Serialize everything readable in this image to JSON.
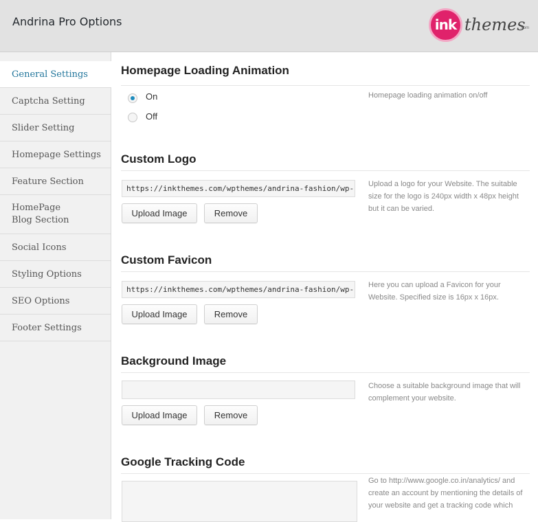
{
  "header": {
    "title": "Andrina Pro Options",
    "logo": {
      "mark": "ink",
      "wordmark": "themes",
      "suffix": ".com"
    }
  },
  "sidebar": {
    "items": [
      {
        "label": "General Settings",
        "active": true
      },
      {
        "label": "Captcha Setting"
      },
      {
        "label": "Slider Setting"
      },
      {
        "label": "Homepage Settings"
      },
      {
        "label": "Feature Section"
      },
      {
        "label": "HomePage Blog Section"
      },
      {
        "label": "Social Icons"
      },
      {
        "label": "Styling Options"
      },
      {
        "label": "SEO Options"
      },
      {
        "label": "Footer Settings"
      }
    ]
  },
  "sections": {
    "animation": {
      "title": "Homepage Loading Animation",
      "options": [
        "On",
        "Off"
      ],
      "selected": "On",
      "description": "Homepage loading animation on/off"
    },
    "logo": {
      "title": "Custom Logo",
      "value": "https://inkthemes.com/wpthemes/andrina-fashion/wp-",
      "upload_label": "Upload Image",
      "remove_label": "Remove",
      "description": "Upload a logo for your Website. The suitable size for the logo is 240px width x 48px height but it can be varied."
    },
    "favicon": {
      "title": "Custom Favicon",
      "value": "https://inkthemes.com/wpthemes/andrina-fashion/wp-",
      "upload_label": "Upload Image",
      "remove_label": "Remove",
      "description": "Here you can upload a Favicon for your Website. Specified size is 16px x 16px."
    },
    "background": {
      "title": "Background Image",
      "value": "",
      "upload_label": "Upload Image",
      "remove_label": "Remove",
      "description": "Choose a suitable background image that will complement your website."
    },
    "tracking": {
      "title": "Google Tracking Code",
      "value": "",
      "description": "Go to http://www.google.co.in/analytics/ and create an account by mentioning the details of your website and get a tracking code which"
    }
  },
  "colors": {
    "accent": "#21759b",
    "radio": "#1e8cbe",
    "logo_pink": "#e0226b"
  }
}
